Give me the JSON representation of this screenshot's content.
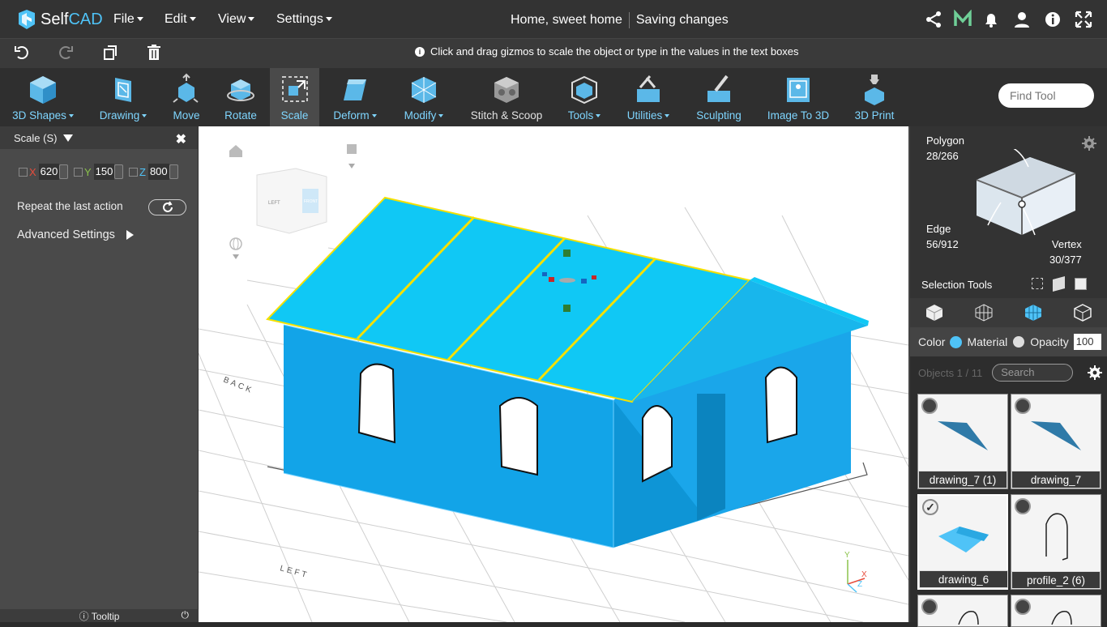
{
  "app": {
    "brand_self": "Self",
    "brand_cad": "CAD"
  },
  "menus": [
    "File",
    "Edit",
    "View",
    "Settings"
  ],
  "project": {
    "name": "Home, sweet home",
    "status": "Saving changes"
  },
  "hint": "Click and drag gizmos to scale the object or type in the values in the text boxes",
  "tools": [
    {
      "label": "3D Shapes",
      "dropdown": true
    },
    {
      "label": "Drawing",
      "dropdown": true
    },
    {
      "label": "Move",
      "dropdown": false
    },
    {
      "label": "Rotate",
      "dropdown": false
    },
    {
      "label": "Scale",
      "dropdown": false,
      "active": true
    },
    {
      "label": "Deform",
      "dropdown": true
    },
    {
      "label": "Modify",
      "dropdown": true
    },
    {
      "label": "Stitch & Scoop",
      "dropdown": false
    },
    {
      "label": "Tools",
      "dropdown": true
    },
    {
      "label": "Utilities",
      "dropdown": true
    },
    {
      "label": "Sculpting",
      "dropdown": false
    },
    {
      "label": "Image To 3D",
      "dropdown": false
    },
    {
      "label": "3D Print",
      "dropdown": false
    }
  ],
  "find_tool_placeholder": "Find Tool",
  "scale_panel": {
    "title": "Scale (S)",
    "x_label": "X",
    "x_value": "620",
    "y_label": "Y",
    "y_value": "150",
    "z_label": "Z",
    "z_value": "800",
    "repeat_label": "Repeat the last action",
    "advanced_label": "Advanced Settings",
    "tooltip_label": "Tooltip"
  },
  "viewport": {
    "label_back": "BACK",
    "label_left": "LEFT",
    "cube_left": "LEFT",
    "cube_front": "FRONT",
    "axis_y": "Y",
    "axis_x": "X",
    "axis_z": "Z"
  },
  "selection": {
    "polygon_label": "Polygon",
    "polygon_count": "28/266",
    "edge_label": "Edge",
    "edge_count": "56/912",
    "vertex_label": "Vertex",
    "vertex_count": "30/377",
    "tools_label": "Selection Tools"
  },
  "properties": {
    "color_label": "Color",
    "material_label": "Material",
    "opacity_label": "Opacity",
    "opacity_value": "100",
    "color": "#4fc3f7"
  },
  "objects": {
    "count_label": "Objects 1 / 11",
    "search_placeholder": "Search"
  },
  "object_cards": [
    {
      "name": "drawing_7 (1)",
      "checked": false
    },
    {
      "name": "drawing_7",
      "checked": false
    },
    {
      "name": "drawing_6",
      "checked": true
    },
    {
      "name": "profile_2 (6)",
      "checked": false
    }
  ],
  "colors": {
    "accent": "#4fc3f7",
    "model": "#12a4e8",
    "roof": "#10c8f5",
    "selection_edge": "#f5e000"
  }
}
